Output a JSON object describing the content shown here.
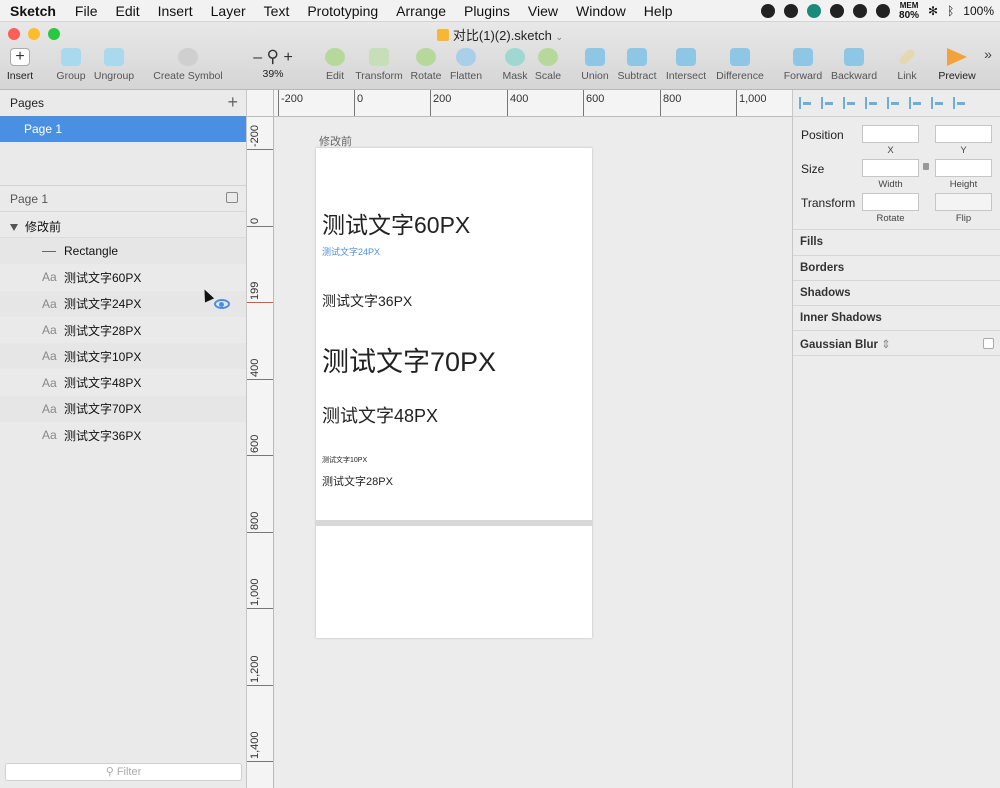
{
  "menubar": {
    "app_name": "Sketch",
    "items": [
      "File",
      "Edit",
      "Insert",
      "Layer",
      "Text",
      "Prototyping",
      "Arrange",
      "Plugins",
      "View",
      "Window",
      "Help"
    ],
    "mem_label": "MEM",
    "mem_value": "80%",
    "battery": "100%"
  },
  "window": {
    "title": "对比(1)(2).sketch"
  },
  "toolbar": {
    "insert": "Insert",
    "group": "Group",
    "ungroup": "Ungroup",
    "create_symbol": "Create Symbol",
    "zoom_minus": "–",
    "zoom_plus": "+",
    "zoom_value": "39%",
    "edit": "Edit",
    "transform": "Transform",
    "rotate": "Rotate",
    "flatten": "Flatten",
    "mask": "Mask",
    "scale": "Scale",
    "union": "Union",
    "subtract": "Subtract",
    "intersect": "Intersect",
    "difference": "Difference",
    "forward": "Forward",
    "backward": "Backward",
    "link": "Link",
    "preview": "Preview",
    "more": "»"
  },
  "pages": {
    "header": "Pages",
    "add": "+",
    "selected": "Page 1"
  },
  "layers": {
    "page_label": "Page 1",
    "group": "修改前",
    "items": [
      {
        "type": "rect",
        "label": "Rectangle"
      },
      {
        "type": "text",
        "icon": "Aa",
        "label": "测试文字60PX"
      },
      {
        "type": "text",
        "icon": "Aa",
        "label": "测试文字24PX"
      },
      {
        "type": "text",
        "icon": "Aa",
        "label": "测试文字28PX"
      },
      {
        "type": "text",
        "icon": "Aa",
        "label": "测试文字10PX"
      },
      {
        "type": "text",
        "icon": "Aa",
        "label": "测试文字48PX"
      },
      {
        "type": "text",
        "icon": "Aa",
        "label": "测试文字70PX"
      },
      {
        "type": "text",
        "icon": "Aa",
        "label": "测试文字36PX"
      }
    ],
    "filter_placeholder": "Filter"
  },
  "ruler_top": [
    "-200",
    "0",
    "200",
    "400",
    "600",
    "800",
    "1,000"
  ],
  "ruler_left": [
    "-200",
    "0",
    "199",
    "400",
    "600",
    "800",
    "1,000",
    "1,200",
    "1,400"
  ],
  "artboard": {
    "label": "修改前",
    "texts": [
      {
        "label": "测试文字60PX",
        "color": "#222222"
      },
      {
        "label": "测试文字24PX",
        "color": "#4a90e2"
      },
      {
        "label": "测试文字36PX",
        "color": "#222222"
      },
      {
        "label": "测试文字70PX",
        "color": "#222222"
      },
      {
        "label": "测试文字48PX",
        "color": "#222222"
      },
      {
        "label": "测试文字10PX",
        "color": "#222222"
      },
      {
        "label": "测试文字28PX",
        "color": "#222222"
      }
    ]
  },
  "inspector": {
    "position": "Position",
    "x": "X",
    "y": "Y",
    "size": "Size",
    "width": "Width",
    "height": "Height",
    "transform": "Transform",
    "rotate": "Rotate",
    "flip": "Flip",
    "sections": [
      "Fills",
      "Borders",
      "Shadows",
      "Inner Shadows",
      "Gaussian Blur"
    ]
  }
}
